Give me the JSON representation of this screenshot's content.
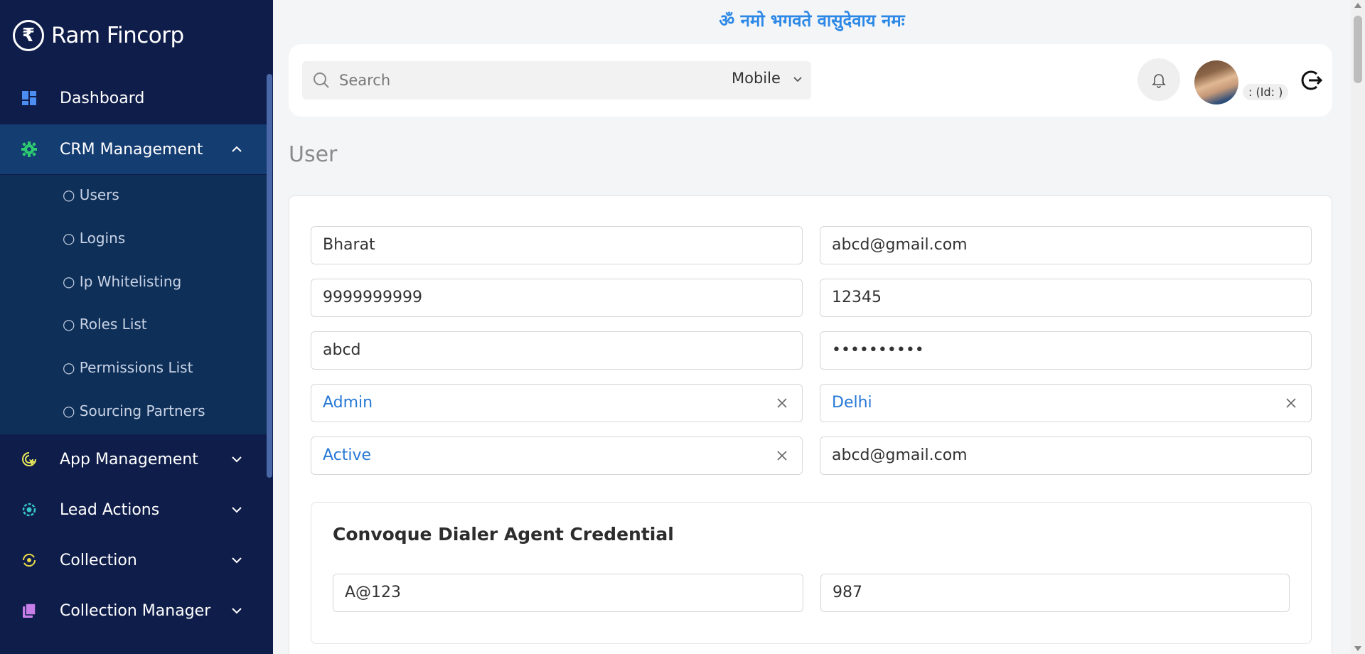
{
  "brand": {
    "name": "Ram Fincorp",
    "logo_glyph": "₹"
  },
  "sidebar": {
    "items": [
      {
        "label": "Dashboard",
        "icon": "dashboard-icon",
        "icon_color": "#4b8df0"
      },
      {
        "label": "CRM Management",
        "icon": "gear-icon",
        "icon_color": "#2ecc71"
      },
      {
        "label": "App Management",
        "icon": "app-cursor-icon",
        "icon_color": "#e8e85a"
      },
      {
        "label": "Lead Actions",
        "icon": "cog-network-icon",
        "icon_color": "#39c6c6"
      },
      {
        "label": "Collection",
        "icon": "refresh-coin-icon",
        "icon_color": "#e8d84a"
      },
      {
        "label": "Collection Manager",
        "icon": "stack-icon",
        "icon_color": "#c77ee8"
      }
    ],
    "crm_submenu": [
      "○ Users",
      "○ Logins",
      "○ Ip Whitelisting",
      "○ Roles List",
      "○ Permissions List",
      "○ Sourcing Partners"
    ],
    "active_color": "#143d72"
  },
  "header": {
    "mantra": "ॐ नमो भगवते वासुदेवाय नमः",
    "search_placeholder": "Search",
    "search_filter": "Mobile",
    "id_tag": ": (Id: )"
  },
  "page": {
    "title": "User",
    "fields": {
      "name": "Bharat",
      "email": "abcd@gmail.com",
      "mobile": "9999999999",
      "code": "12345",
      "username": "abcd",
      "password": "••••••••••",
      "role": "Admin",
      "city": "Delhi",
      "status": "Active",
      "email2": "abcd@gmail.com"
    },
    "dialer": {
      "title": "Convoque Dialer Agent Credential",
      "password": "A@123",
      "agent_id": "987"
    }
  },
  "colors": {
    "sidebar_bg": "#0f1d4a",
    "accent_blue": "#2778d6",
    "mantra": "#2c88e6"
  }
}
